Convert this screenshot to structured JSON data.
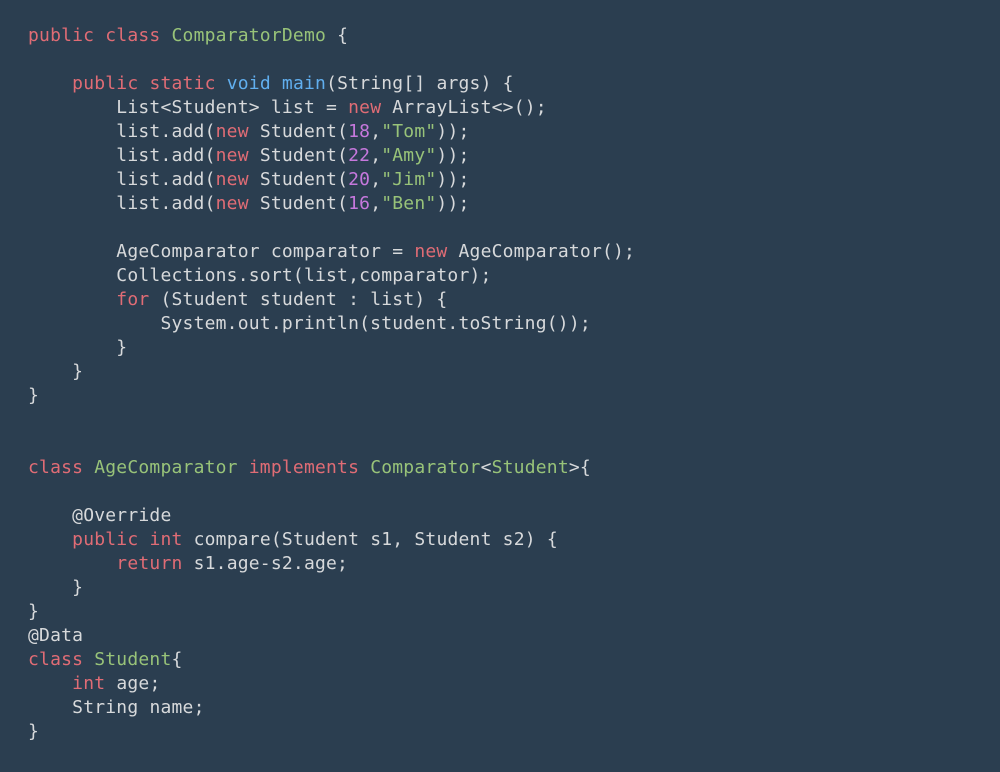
{
  "code": {
    "class1_name": "ComparatorDemo",
    "main_sig_void": "void",
    "main_sig_name": "main",
    "list_decl_type": "List",
    "list_generic": "Student",
    "list_var": "list",
    "arraylist": "ArrayList",
    "students": [
      {
        "age": "18",
        "name": "\"Tom\""
      },
      {
        "age": "22",
        "name": "\"Amy\""
      },
      {
        "age": "20",
        "name": "\"Jim\""
      },
      {
        "age": "16",
        "name": "\"Ben\""
      }
    ],
    "comparator_type": "AgeComparator",
    "comparator_var": "comparator",
    "collections": "Collections",
    "sort": "sort",
    "for_type": "Student",
    "for_var": "student",
    "println_call": "System.out.println(student.toString());",
    "class2_name": "AgeComparator",
    "implements": "implements",
    "comparator_iface": "Comparator",
    "override": "@Override",
    "compare_name": "compare",
    "s1": "s1",
    "s2": "s2",
    "return_expr": "s1.age-s2.age;",
    "data_ann": "@Data",
    "class3_name": "Student",
    "field_int": "int",
    "field_age": "age;",
    "field_string": "String",
    "field_name": "name;",
    "kw": {
      "public": "public",
      "class": "class",
      "static": "static",
      "new": "new",
      "for": "for",
      "return": "return",
      "int": "int",
      "implements": "implements"
    }
  }
}
